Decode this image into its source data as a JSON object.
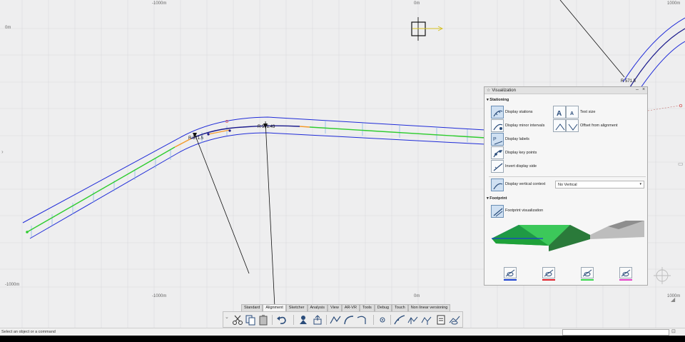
{
  "axes": {
    "x_top_left": "-1000m",
    "x_top_center": "0m",
    "x_top_right": "1000m",
    "y_left_upper": "0m",
    "y_left_lower": "-1000m",
    "x_bottom_left": "-1000m",
    "x_bottom_center": "0m",
    "x_bottom_right": "1000m"
  },
  "radii": {
    "left": "R 571.5",
    "middle": "R 571.43",
    "right": "R 571.5"
  },
  "colors": {
    "alignment_edge": "#1f2bd8",
    "tangent": "#2ecc2e",
    "curve": "#f39a2b",
    "arc": "#1a1a8c",
    "station_tick": "#7fb3e6"
  },
  "panel": {
    "title": "Visualization",
    "stationing": {
      "heading": "Stationing",
      "display_stations": "Display stations",
      "display_minor_intervals": "Display minor intervals",
      "display_labels": "Display labels",
      "display_key_points": "Display key points",
      "invert_display_side": "Invert display side",
      "text_size": "Text size",
      "offset_from_alignment": "Offset from alignment",
      "display_vertical_context": "Display vertical context",
      "vertical_select": "No Vertical"
    },
    "footprint": {
      "heading": "Footprint",
      "footprint_visualization": "Footprint visualization",
      "swatches": [
        "#1a3fd1",
        "#e0202a",
        "#35d84a",
        "#e43dc8"
      ]
    }
  },
  "tabs": [
    "Standard",
    "Alignment",
    "Sketcher",
    "Analysis",
    "View",
    "AR-VR",
    "Tools",
    "Debug",
    "Touch",
    "Non linear versioning"
  ],
  "active_tab": "Alignment",
  "status": {
    "message": "Select an object or a command",
    "command_input": ""
  },
  "toolbar_icons": [
    "scissors-icon",
    "copy-icon",
    "paste-icon",
    "undo-icon",
    "properties-icon",
    "export-icon",
    "polyline-icon",
    "arc-icon",
    "curve-icon",
    "point-icon",
    "transition-icon",
    "alignment-icon",
    "alignment-edit-icon",
    "report-icon",
    "visualization-icon"
  ]
}
